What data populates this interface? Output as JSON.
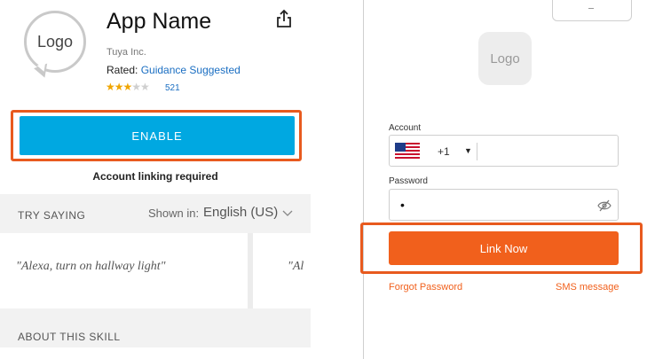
{
  "skill": {
    "logo_text": "Logo",
    "title": "App Name",
    "developer": "Tuya Inc.",
    "rated_prefix": "Rated: ",
    "rated_value": "Guidance Suggested",
    "stars_filled": "★★★",
    "stars_empty": "★★",
    "rating_value": 3,
    "rating_count": "521",
    "enable_label": "ENABLE",
    "linking_note": "Account linking required"
  },
  "try_saying": {
    "label": "TRY SAYING",
    "shown_in_label": "Shown in:",
    "language": "English (US)",
    "quotes": [
      "\"Alexa, turn on hallway light\"",
      "\"Al"
    ]
  },
  "about": {
    "label": "ABOUT THIS SKILL"
  },
  "login": {
    "logo_text": "Logo",
    "account_label": "Account",
    "country_code": "+1",
    "password_label": "Password",
    "password_value": "•",
    "link_now_label": "Link Now",
    "forgot_label": "Forgot Password",
    "sms_label": "SMS message"
  },
  "colors": {
    "enable_blue": "#00a8e1",
    "link_orange": "#f1601c",
    "highlight_frame": "#e85a1e"
  },
  "icons": [
    "share-icon",
    "chevron-down-icon",
    "us-flag-icon",
    "dropdown-arrow-icon",
    "eye-off-icon"
  ]
}
